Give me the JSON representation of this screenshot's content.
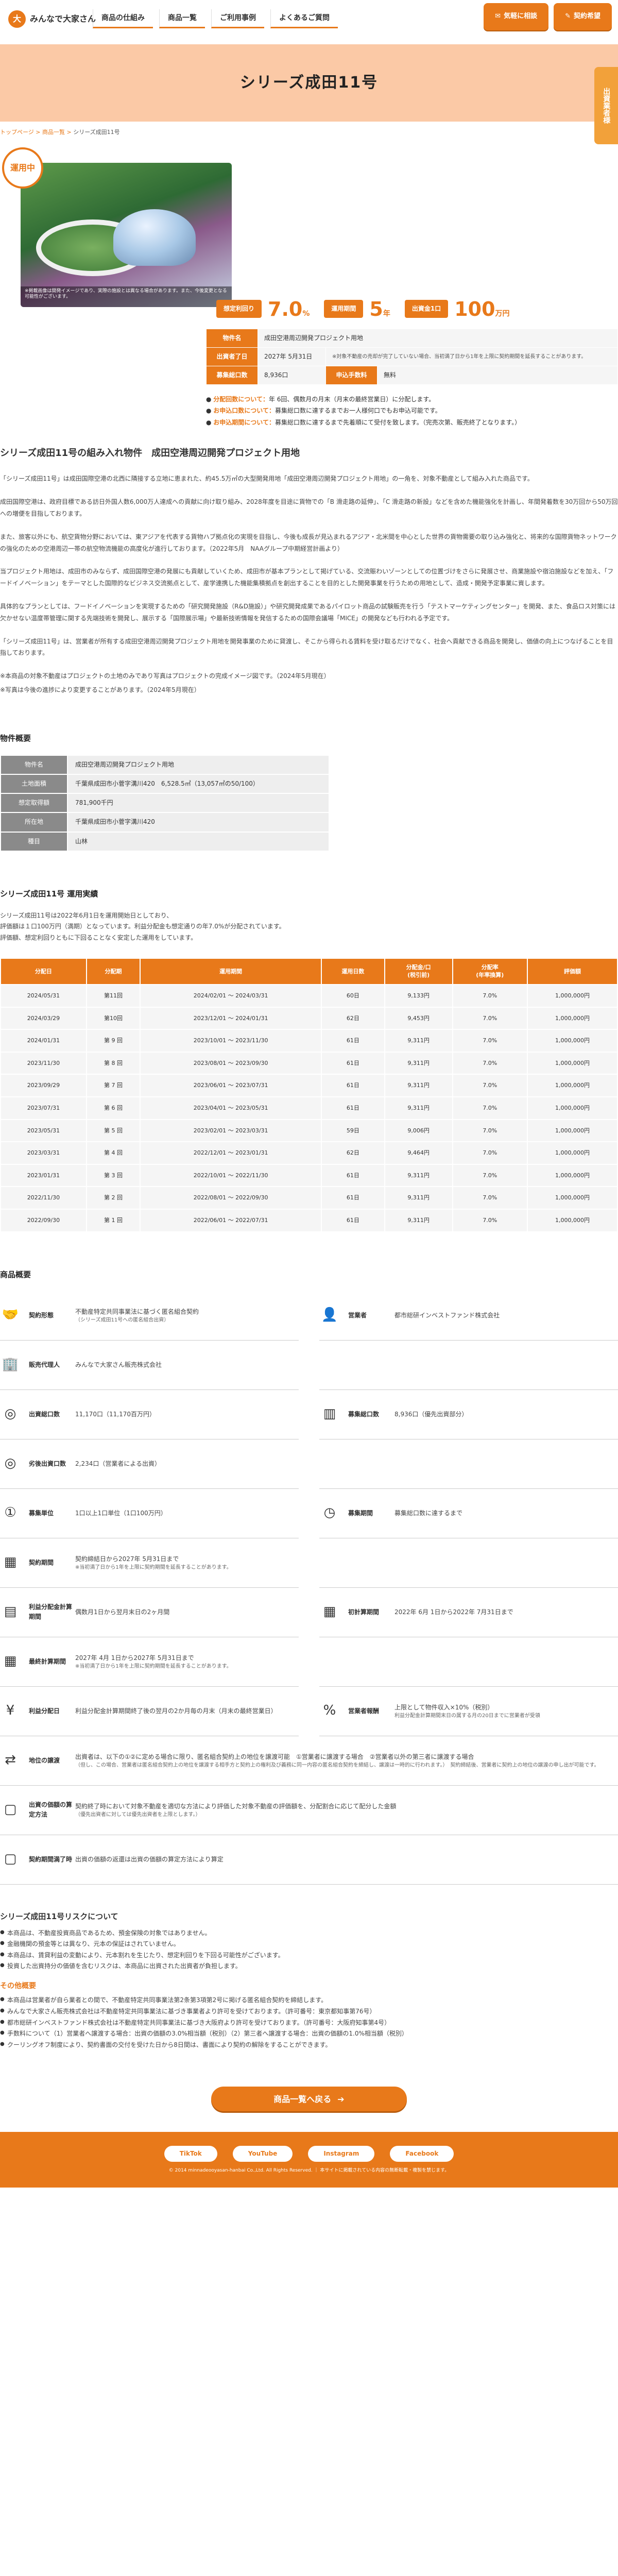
{
  "header": {
    "logo": "みんなで大家さん",
    "nav": [
      "商品の仕組み",
      "商品一覧",
      "ご利用事例",
      "よくあるご質問"
    ],
    "btn_consult": "気軽に相談",
    "btn_contract": "契約希望",
    "side_tab": "出資業者様"
  },
  "hero": {
    "title": "シリーズ成田11号"
  },
  "breadcrumb": {
    "home": "トップページ",
    "sep1": " > ",
    "list": "商品一覧",
    "sep2": " > ",
    "current": "シリーズ成田11号"
  },
  "product": {
    "status": "運用中",
    "img_caption": "※掲載画像は開発イメージであり、実際の施設とは異なる場合があります。また、今後変更となる可能性がございます。",
    "kpis": [
      {
        "label": "想定利回り",
        "value": "7.0",
        "unit": "%"
      },
      {
        "label": "運用期間",
        "value": "5",
        "unit": "年"
      },
      {
        "label": "出資金1口",
        "value": "100",
        "unit": "万円"
      }
    ],
    "spec": {
      "name_label": "物件名",
      "name_value": "成田空港周辺開発プロジェクト用地",
      "date_label": "出資者了日",
      "date_value": "2027年 5月31日",
      "date_note": "※対象不動産の売却が完了していない場合、当初満了日から1年を上限に契約期間を延長することがあります。",
      "units_label": "募集総口数",
      "units_value": "8,936口",
      "fee_label": "申込手数料",
      "fee_value": "無料"
    },
    "notes": [
      {
        "k": "分配回数について：",
        "v": "年 6回、偶数月の月末（月末の最終営業日）に分配します。"
      },
      {
        "k": "お申込口数について：",
        "v": "募集総口数に達するまでお一人様何口でもお申込可能です。"
      },
      {
        "k": "お申込期間について：",
        "v": "募集総口数に達するまで先着順にて受付を致します。（完売次第、販売終了となります。）"
      }
    ]
  },
  "article": {
    "title": "シリーズ成田11号の組み入れ物件　成田空港周辺開発プロジェクト用地",
    "p1": "「シリーズ成田11号」は成田国際空港の北西に隣接する立地に恵まれた、約45.5万㎡の大型開発用地「成田空港周辺開発プロジェクト用地」の一角を、対象不動産として組み入れた商品です。",
    "p2": "成田国際空港は、政府目標である訪日外国人数6,000万人達成への貢献に向け取り組み、2028年度を目途に貨物での「B 滑走路の延伸」、「C 滑走路の新設」などを含めた機能強化を計画し、年間発着数を30万回から50万回への増便を目指しております。",
    "p3": "また、旅客以外にも、航空貨物分野においては、東アジアを代表する貨物ハブ拠点化の実現を目指し、今後も成長が見込まれるアジア・北米間を中心とした世界の貨物需要の取り込み強化と、将来的な国際貨物ネットワークの強化のための空港周辺一帯の航空物流機能の高度化が進行しております。（2022年5月　NAAグループ中期経営計画より）",
    "p4": "当プロジェクト用地は、成田市のみならず、成田国際空港の発展にも貢献していくため、成田市が基本プランとして掲げている、交流賑わいゾーンとしての位置づけをさらに発展させ、商業施設や宿泊施設などを加え、「フードイノベーション」をテーマとした国際的なビジネス交流拠点として、産学連携した機能集積拠点を創出することを目的とした開発事業を行うための用地として、造成・開発予定事業に資します。",
    "p5": "具体的なプランとしては、フードイノベーションを実現するための「研究開発施設（R&D施設）」や研究開発成果であるパイロット商品の試験販売を行う「テストマーケティングセンター」を開発、また、食品ロス対策には欠かせない温度帯管理に関する先端技術を開発し、展示する「国際展示場」や最新技術情報を発信するための国際会議場「MICE」の開発なども行われる予定です。",
    "p6": "「シリーズ成田11号」は、営業者が所有する成田空港周辺開発プロジェクト用地を開発事業のために貸渡し、そこから得られる賃料を受け取るだけでなく、社会へ貢献できる商品を開発し、価値の向上につなげることを目指しております。",
    "n1": "※本商品の対象不動産はプロジェクトの土地のみであり写真はプロジェクトの完成イメージ図です。（2024年5月現在）",
    "n2": "※写真は今後の進捗により変更することがあります。（2024年5月現在）"
  },
  "property": {
    "title": "物件概要",
    "rows": [
      {
        "label": "物件名",
        "value": "成田空港周辺開発プロジェクト用地"
      },
      {
        "label": "土地面積",
        "value": "千葉県成田市小菅字溝川420　6,528.5㎡（13,057㎡の50/100）"
      },
      {
        "label": "想定取得額",
        "value": "781,900千円"
      },
      {
        "label": "所在地",
        "value": "千葉県成田市小菅字溝川420"
      },
      {
        "label": "種目",
        "value": "山林"
      }
    ]
  },
  "performance": {
    "title": "シリーズ成田11号 運用実績",
    "intro1": "シリーズ成田11号は2022年6月1日を運用開始日としており、",
    "intro2": "評価額は１口100万円（満期）となっています。利益分配金も想定通りの年7.0%が分配されています。",
    "intro3": "評価額、想定利回りともに下回ることなく安定した運用をしています。",
    "headers": [
      "分配日",
      "分配期",
      "運用期間",
      "運用日数",
      "分配金/口\n(税引前)",
      "分配率\n(年率換算)",
      "評価額"
    ],
    "rows": [
      [
        "2024/05/31",
        "第11回",
        "2024/02/01 〜 2024/03/31",
        "60日",
        "9,133円",
        "7.0%",
        "1,000,000円"
      ],
      [
        "2024/03/29",
        "第10回",
        "2023/12/01 〜 2024/01/31",
        "62日",
        "9,453円",
        "7.0%",
        "1,000,000円"
      ],
      [
        "2024/01/31",
        "第 9 回",
        "2023/10/01 〜 2023/11/30",
        "61日",
        "9,311円",
        "7.0%",
        "1,000,000円"
      ],
      [
        "2023/11/30",
        "第 8 回",
        "2023/08/01 〜 2023/09/30",
        "61日",
        "9,311円",
        "7.0%",
        "1,000,000円"
      ],
      [
        "2023/09/29",
        "第 7 回",
        "2023/06/01 〜 2023/07/31",
        "61日",
        "9,311円",
        "7.0%",
        "1,000,000円"
      ],
      [
        "2023/07/31",
        "第 6 回",
        "2023/04/01 〜 2023/05/31",
        "61日",
        "9,311円",
        "7.0%",
        "1,000,000円"
      ],
      [
        "2023/05/31",
        "第 5 回",
        "2023/02/01 〜 2023/03/31",
        "59日",
        "9,006円",
        "7.0%",
        "1,000,000円"
      ],
      [
        "2023/03/31",
        "第 4 回",
        "2022/12/01 〜 2023/01/31",
        "62日",
        "9,464円",
        "7.0%",
        "1,000,000円"
      ],
      [
        "2023/01/31",
        "第 3 回",
        "2022/10/01 〜 2022/11/30",
        "61日",
        "9,311円",
        "7.0%",
        "1,000,000円"
      ],
      [
        "2022/11/30",
        "第 2 回",
        "2022/08/01 〜 2022/09/30",
        "61日",
        "9,311円",
        "7.0%",
        "1,000,000円"
      ],
      [
        "2022/09/30",
        "第 1 回",
        "2022/06/01 〜 2022/07/31",
        "61日",
        "9,311円",
        "7.0%",
        "1,000,000円"
      ]
    ]
  },
  "overview": {
    "title": "商品概要",
    "items": [
      {
        "icon": "handshake-icon",
        "label": "契約形態",
        "value": "不動産特定共同事業法に基づく匿名組合契約",
        "sub": "（シリーズ成田11号への匿名組合出資）"
      },
      {
        "icon": "person-icon",
        "label": "営業者",
        "value": "都市総研インベストファンド株式会社",
        "sub": ""
      },
      {
        "icon": "building-icon",
        "label": "販売代理人",
        "value": "みんなで大家さん販売株式会社",
        "sub": ""
      },
      {
        "icon": "blank-icon",
        "label": "",
        "value": "",
        "sub": ""
      },
      {
        "icon": "coins-icon",
        "label": "出資総口数",
        "value": "11,170口（11,170百万円）",
        "sub": ""
      },
      {
        "icon": "bars-icon",
        "label": "募集総口数",
        "value": "8,936口（優先出資部分）",
        "sub": ""
      },
      {
        "icon": "coins2-icon",
        "label": "劣後出資口数",
        "value": "2,234口（営業者による出資）",
        "sub": ""
      },
      {
        "icon": "blank-icon",
        "label": "",
        "value": "",
        "sub": ""
      },
      {
        "icon": "unit-icon",
        "label": "募集単位",
        "value": "1口以上1口単位（1口100万円）",
        "sub": ""
      },
      {
        "icon": "clock-icon",
        "label": "募集期間",
        "value": "募集総口数に達するまで",
        "sub": ""
      },
      {
        "icon": "calendar-icon",
        "label": "契約期間",
        "value": "契約締結日から2027年 5月31日まで",
        "sub": "※当初満了日から1年を上限に契約期間を延長することがあります。"
      },
      {
        "icon": "blank-icon",
        "label": "",
        "value": "",
        "sub": ""
      },
      {
        "icon": "calc-icon",
        "label": "利益分配金計算期間",
        "value": "偶数月1日から翌月末日の2ヶ月間",
        "sub": ""
      },
      {
        "icon": "calendar2-icon",
        "label": "初計算期間",
        "value": "2022年 6月 1日から2022年 7月31日まで",
        "sub": ""
      },
      {
        "icon": "calendar3-icon",
        "label": "最終計算期間",
        "value": "2027年 4月 1日から2027年 5月31日まで",
        "sub": "※当初満了日から1年を上限に契約期間を延長することがあります。"
      },
      {
        "icon": "blank-icon",
        "label": "",
        "value": "",
        "sub": ""
      },
      {
        "icon": "money-icon",
        "label": "利益分配日",
        "value": "利益分配金計算期間終了後の翌月の2か月毎の月末（月末の最終営業日）",
        "sub": ""
      },
      {
        "icon": "fee-icon",
        "label": "営業者報酬",
        "value": "上限として物件収入×10%（税別）",
        "sub": "利益分配金計算期間末日の属する月の20日までに営業者が受領"
      },
      {
        "icon": "transfer-icon",
        "label": "地位の譲渡",
        "value": "出資者は、以下の①②に定める場合に限り、匿名組合契約上の地位を譲渡可能　①営業者に譲渡する場合　②営業者以外の第三者に譲渡する場合",
        "sub": "（但し、この場合、営業者は匿名組合契約上の地位を譲渡する相手方と契約上の権利及び義務に同一内容の匿名組合契約を締結し、譲渡は一時的に行われます。）　契約締結後、営業者に契約上の地位の譲渡の申し出が可能です。"
      },
      {
        "icon": "doc-icon",
        "label": "出資の価額の算定方法",
        "value": "契約終了時において対象不動産を適切な方法により評価した対象不動産の評価額を、分配割合に応じて配分した金額",
        "sub": "（優先出資者に対しては優先出資者を上限とします。）"
      },
      {
        "icon": "doc2-icon",
        "label": "契約期間満了時",
        "value": "出資の価額の返還は出資の価額の算定方法により算定",
        "sub": ""
      }
    ]
  },
  "risk": {
    "title": "シリーズ成田11号リスクについて",
    "items": [
      "本商品は、不動産投資商品であるため、預金保険の対象ではありません。",
      "金融機関の預金等とは異なり、元本の保証はされていません。",
      "本商品は、賃貸利益の変動により、元本割れを生じたり、想定利回りを下回る可能性がございます。",
      "投資した出資持分の価値を含むリスクは、本商品に出資された出資者が負担します。"
    ],
    "other_title": "その他概要",
    "other_items": [
      "本商品は営業者が自ら業者との間で、不動産特定共同事業法第2条第3項第2号に掲げる匿名組合契約を締結します。",
      "みんなで大家さん販売株式会社は不動産特定共同事業法に基づき事業者より許可を受けております。（許可番号：東京都知事第76号）",
      "都市総研インベストファンド株式会社は不動産特定共同事業法に基づき大阪府より許可を受けております。（許可番号：大阪府知事第4号）",
      "手数料について（1）営業者へ譲渡する場合：出資の価額の3.0%相当額（税別）（2）第三者へ譲渡する場合：出資の価額の1.0%相当額（税別）",
      "クーリングオフ制度により、契約書面の交付を受けた日から8日間は、書面により契約の解除をすることができます。"
    ]
  },
  "back_button": "商品一覧へ戻る",
  "footer": {
    "sns": [
      "TikTok",
      "YouTube",
      "Instagram",
      "Facebook"
    ],
    "copyright": "© 2014 minnadeooyasan-hanbai Co.,Ltd. All Rights Reserved. ｜ 本サイトに掲載されている内容の無断転載・複製を禁じます。"
  },
  "colors": {
    "accent": "#e8791a",
    "hero_bg": "#fbc9a6",
    "table_gray": "#8a8a8a"
  }
}
